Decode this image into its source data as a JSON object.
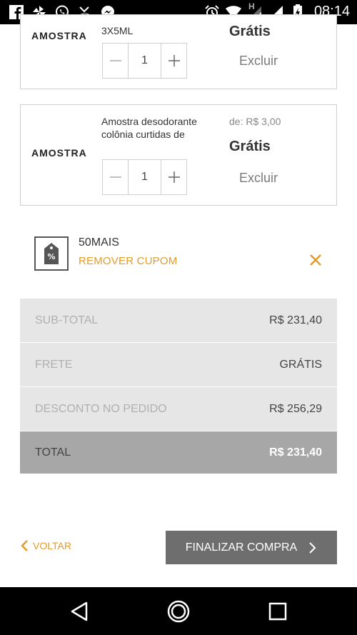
{
  "status_bar": {
    "time": "08:14",
    "icons": [
      "facebook-icon",
      "pinwheel-app-icon",
      "whatsapp-icon",
      "missed-call-icon",
      "messenger-icon",
      "alarm-icon",
      "wifi-icon",
      "h-network-icon",
      "signal-icon",
      "battery-icon"
    ],
    "network_label": "H"
  },
  "cart": {
    "items": [
      {
        "brand": "AMOSTRA",
        "name": "3X5ML",
        "quantity": "1",
        "price": "Grátis",
        "remove_label": "Excluir"
      },
      {
        "brand": "AMOSTRA",
        "name": "Amostra desodorante colônia curtidas de",
        "old_price": "de:  R$ 3,00",
        "quantity": "1",
        "price": "Grátis",
        "remove_label": "Excluir"
      }
    ]
  },
  "coupon": {
    "code": "50MAIS",
    "remove_label": "REMOVER CUPOM",
    "icon": "coupon-tag-icon",
    "accent_color": "#e59b2a"
  },
  "totals": {
    "subtotal_label": "SUB-TOTAL",
    "subtotal_value": "R$ 231,40",
    "shipping_label": "FRETE",
    "shipping_value": "GRÁTIS",
    "discount_label": "DESCONTO NO PEDIDO",
    "discount_value": "R$ 256,29",
    "total_label": "TOTAL",
    "total_value": "R$ 231,40"
  },
  "actions": {
    "back_label": "VOLTAR",
    "finish_label": "FINALIZAR COMPRA"
  },
  "nav": {
    "icons": [
      "back-triangle-icon",
      "home-circle-icon",
      "recents-square-icon"
    ]
  }
}
